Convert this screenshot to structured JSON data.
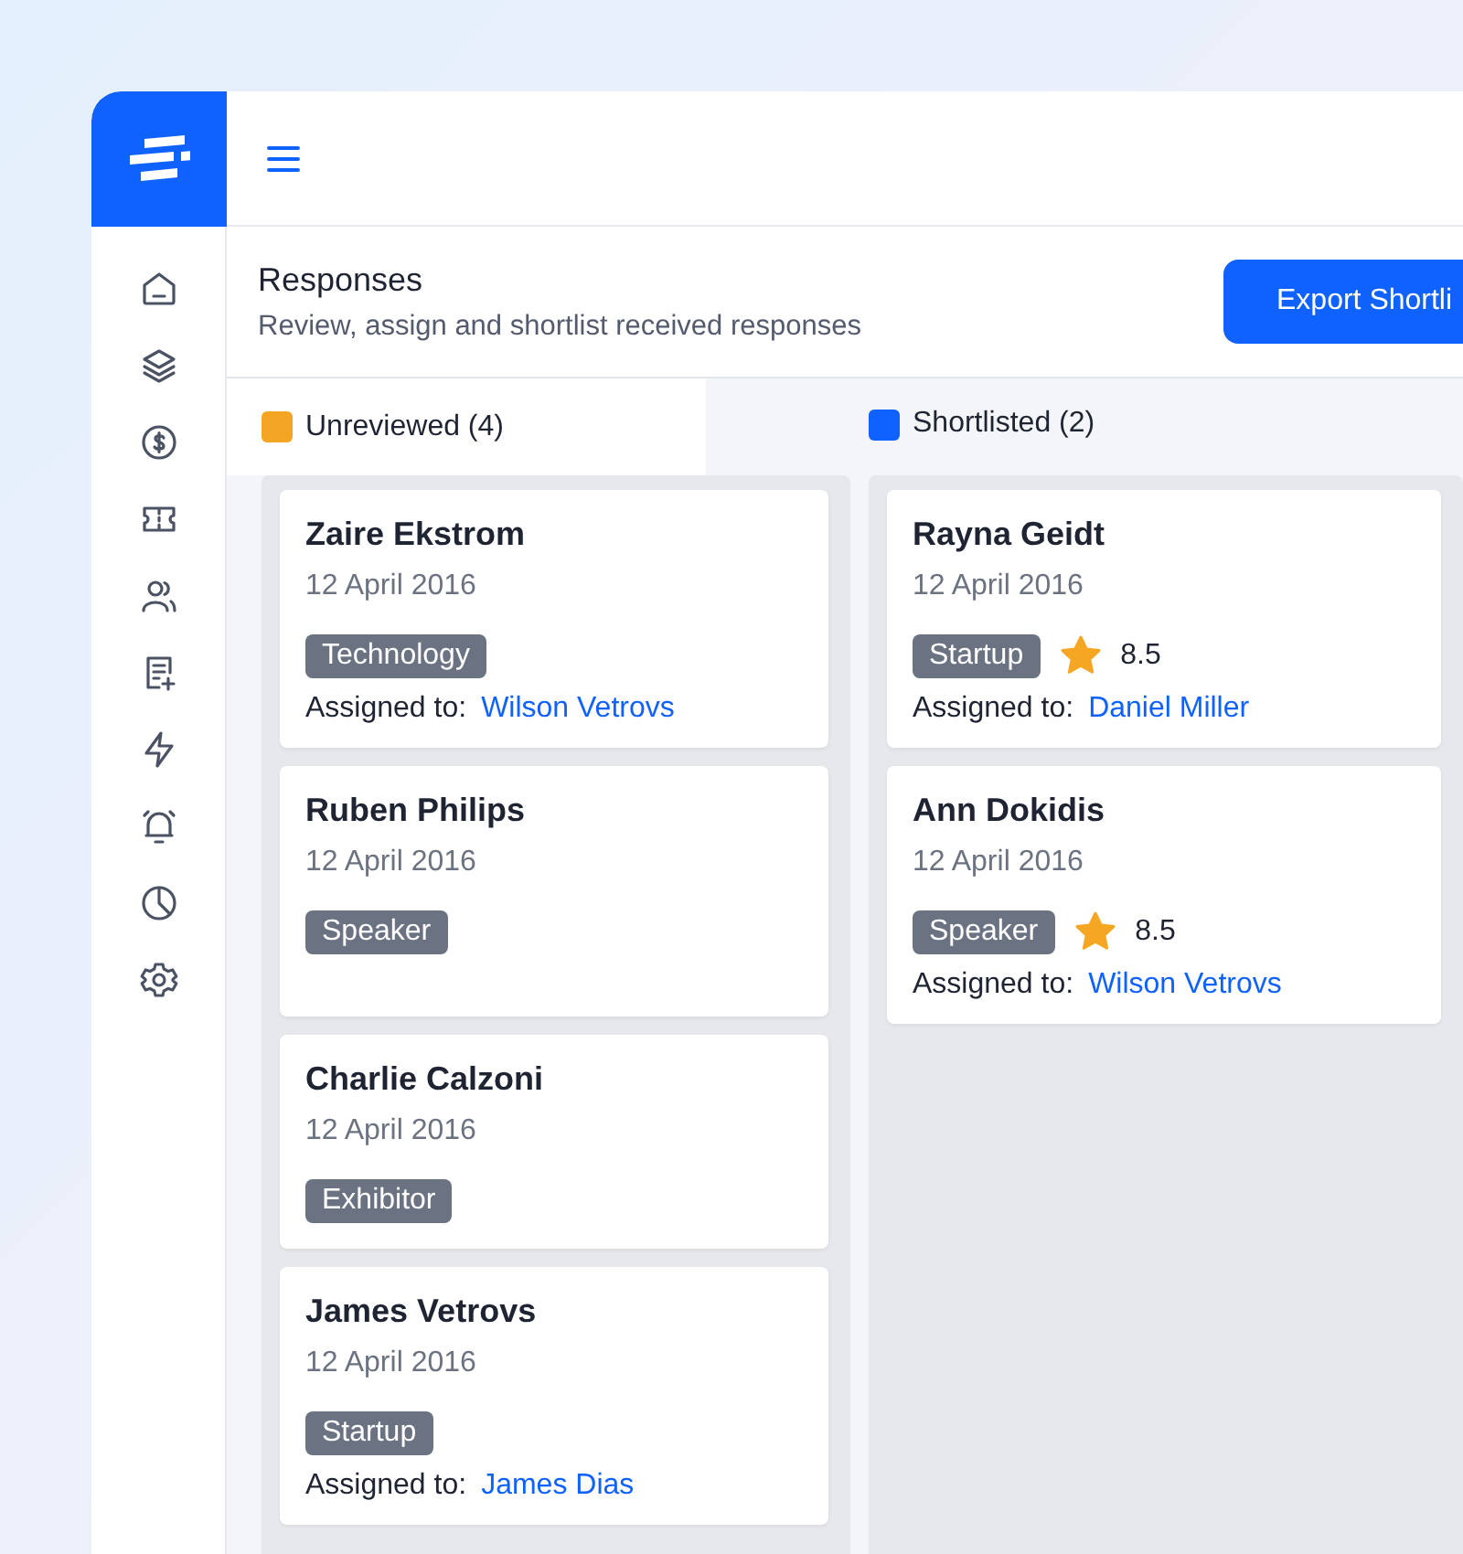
{
  "header": {
    "title": "Responses",
    "subtitle": "Review, assign and shortlist received responses",
    "button": "Export Shortli"
  },
  "sidebar": {
    "items": [
      {
        "kind": "home"
      },
      {
        "kind": "layers"
      },
      {
        "kind": "dollar"
      },
      {
        "kind": "ticket"
      },
      {
        "kind": "users"
      },
      {
        "kind": "form"
      },
      {
        "kind": "bolt"
      },
      {
        "kind": "bell"
      },
      {
        "kind": "pie"
      },
      {
        "kind": "gear"
      }
    ]
  },
  "columns": [
    {
      "title": "Unreviewed (4)",
      "color": "#f5a524",
      "cards": [
        {
          "name": "Zaire Ekstrom",
          "date": "12 April 2016",
          "tag": "Technology",
          "assigned_label": "Assigned to:",
          "assignee": "Wilson Vetrovs"
        },
        {
          "name": "Ruben Philips",
          "date": "12 April 2016",
          "tag": "Speaker"
        },
        {
          "name": "Charlie Calzoni",
          "date": "12 April 2016",
          "tag": "Exhibitor"
        },
        {
          "name": "James Vetrovs",
          "date": "12 April 2016",
          "tag": "Startup",
          "assigned_label": "Assigned to:",
          "assignee": "James Dias"
        }
      ]
    },
    {
      "title": "Shortlisted (2)",
      "color": "#0f62fe",
      "cards": [
        {
          "name": "Rayna Geidt",
          "date": "12 April 2016",
          "tag": "Startup",
          "rating": "8.5",
          "assigned_label": "Assigned to:",
          "assignee": "Daniel Miller"
        },
        {
          "name": "Ann Dokidis",
          "date": "12 April 2016",
          "tag": "Speaker",
          "rating": "8.5",
          "assigned_label": "Assigned to:",
          "assignee": "Wilson Vetrovs"
        }
      ]
    }
  ]
}
